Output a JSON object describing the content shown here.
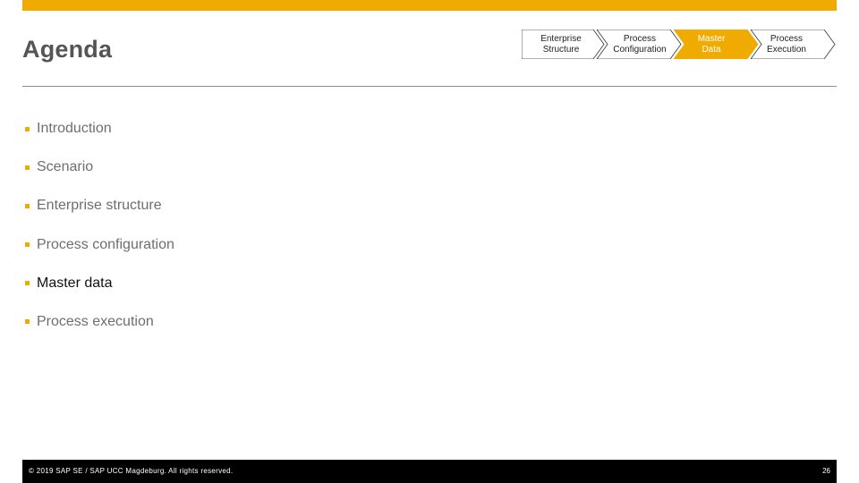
{
  "slide": {
    "title": "Agenda"
  },
  "colors": {
    "accent": "#f0ab00",
    "footer_bg": "#000000"
  },
  "process_chevrons": [
    {
      "label": "Enterprise\nStructure",
      "active": false
    },
    {
      "label": "Process\nConfiguration",
      "active": false
    },
    {
      "label": "Master\nData",
      "active": true
    },
    {
      "label": "Process\nExecution",
      "active": false
    }
  ],
  "agenda": {
    "items": [
      {
        "label": "Introduction",
        "active": false
      },
      {
        "label": "Scenario",
        "active": false
      },
      {
        "label": "Enterprise structure",
        "active": false
      },
      {
        "label": "Process configuration",
        "active": false
      },
      {
        "label": "Master data",
        "active": true
      },
      {
        "label": "Process execution",
        "active": false
      }
    ]
  },
  "footer": {
    "copyright": "© 2019 SAP SE / SAP UCC Magdeburg. All rights reserved.",
    "page_number": "26"
  }
}
